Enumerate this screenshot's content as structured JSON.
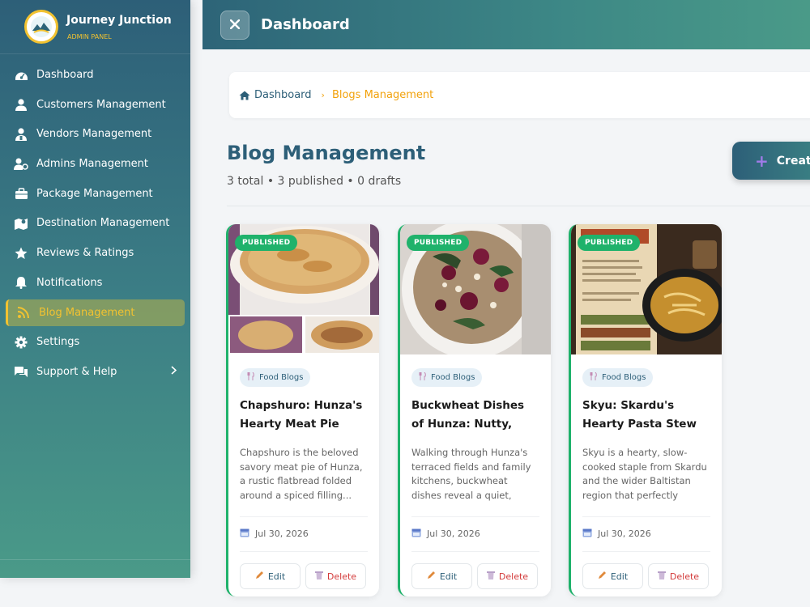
{
  "brand": {
    "title": "Journey Junction",
    "subtitle": "ADMIN PANEL"
  },
  "sidebar": {
    "items": [
      {
        "label": "Dashboard",
        "icon": "dashboard-icon"
      },
      {
        "label": "Customers Management",
        "icon": "user-icon"
      },
      {
        "label": "Vendors Management",
        "icon": "vendor-icon"
      },
      {
        "label": "Admins Management",
        "icon": "admin-icon"
      },
      {
        "label": "Package Management",
        "icon": "package-icon"
      },
      {
        "label": "Destination Management",
        "icon": "map-icon"
      },
      {
        "label": "Reviews & Ratings",
        "icon": "star-icon"
      },
      {
        "label": "Notifications",
        "icon": "bell-icon"
      },
      {
        "label": "Blog Management",
        "icon": "blog-icon",
        "active": true
      },
      {
        "label": "Settings",
        "icon": "gear-icon"
      },
      {
        "label": "Support & Help",
        "icon": "chat-icon"
      }
    ]
  },
  "header": {
    "title": "Dashboard"
  },
  "breadcrumb": {
    "home": "Dashboard",
    "separator": "›",
    "current": "Blogs Management"
  },
  "main": {
    "title": "Blog Management",
    "stats": "3 total • 3 published • 0 drafts",
    "create_label": "Create"
  },
  "posts": [
    {
      "status": "PUBLISHED",
      "category": "Food Blogs",
      "title": "Chapshuro: Hunza's Hearty Meat Pie",
      "excerpt": "Chapshuro is the beloved savory meat pie of Hunza, a rustic flatbread folded around a spiced filling...",
      "date": "Jul 30, 2026",
      "edit_label": "Edit",
      "delete_label": "Delete"
    },
    {
      "status": "PUBLISHED",
      "category": "Food Blogs",
      "title": "Buckwheat Dishes of Hunza: Nutty, Heart...",
      "excerpt": "Walking through Hunza's terraced fields and family kitchens, buckwheat dishes reveal a quiet, nouris...",
      "date": "Jul 30, 2026",
      "edit_label": "Edit",
      "delete_label": "Delete"
    },
    {
      "status": "PUBLISHED",
      "category": "Food Blogs",
      "title": "Skyu: Skardu's Hearty Pasta Stew",
      "excerpt": "Skyu is a hearty, slow-cooked staple from Skardu and the wider Baltistan region that perfectly captu...",
      "date": "Jul 30, 2026",
      "edit_label": "Edit",
      "delete_label": "Delete"
    }
  ],
  "colors": {
    "accent": "#2d5f78",
    "gold": "#f2c230",
    "published": "#1fb26b",
    "delete": "#d33a3a"
  }
}
